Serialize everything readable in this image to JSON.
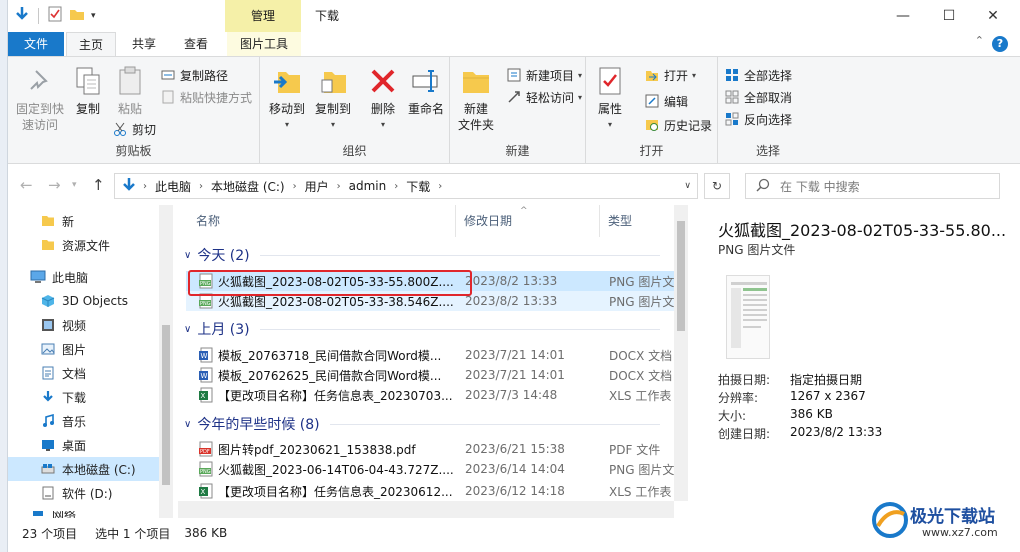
{
  "window": {
    "title": "下载",
    "manage_tab": "管理"
  },
  "tabs": {
    "file": "文件",
    "home": "主页",
    "share": "共享",
    "view": "查看",
    "picture_tools": "图片工具"
  },
  "ribbon": {
    "clipboard": {
      "label": "剪贴板",
      "pin": "固定到快\n速访问",
      "copy": "复制",
      "paste": "粘贴",
      "copy_path": "复制路径",
      "paste_shortcut": "粘贴快捷方式",
      "cut": "剪切"
    },
    "organize": {
      "label": "组织",
      "move_to": "移动到",
      "copy_to": "复制到",
      "delete": "删除",
      "rename": "重命名"
    },
    "new": {
      "label": "新建",
      "new_folder": "新建\n文件夹",
      "new_item": "新建项目",
      "easy_access": "轻松访问"
    },
    "open": {
      "label": "打开",
      "properties": "属性",
      "open": "打开",
      "edit": "编辑",
      "history": "历史记录"
    },
    "select": {
      "label": "选择",
      "select_all": "全部选择",
      "select_none": "全部取消",
      "invert": "反向选择"
    }
  },
  "address": {
    "crumbs": [
      "此电脑",
      "本地磁盘 (C:)",
      "用户",
      "admin",
      "下载"
    ],
    "search_placeholder": "在 下载 中搜索"
  },
  "nav": {
    "items": [
      {
        "label": "新",
        "icon": "folder-icon"
      },
      {
        "label": "资源文件",
        "icon": "folder-icon"
      },
      {
        "label": "此电脑",
        "icon": "computer-icon"
      },
      {
        "label": "3D Objects",
        "icon": "cube-icon"
      },
      {
        "label": "视频",
        "icon": "video-icon"
      },
      {
        "label": "图片",
        "icon": "picture-icon"
      },
      {
        "label": "文档",
        "icon": "document-icon"
      },
      {
        "label": "下载",
        "icon": "download-icon"
      },
      {
        "label": "音乐",
        "icon": "music-icon"
      },
      {
        "label": "桌面",
        "icon": "desktop-icon"
      },
      {
        "label": "本地磁盘 (C:)",
        "icon": "drive-icon"
      },
      {
        "label": "软件 (D:)",
        "icon": "drive-icon"
      },
      {
        "label": "网络",
        "icon": "network-icon"
      }
    ]
  },
  "columns": {
    "name": "名称",
    "date": "修改日期",
    "type": "类型"
  },
  "groups": [
    {
      "title": "今天 (2)",
      "files": [
        {
          "name": "火狐截图_2023-08-02T05-33-55.800Z....",
          "date": "2023/8/2 13:33",
          "type": "PNG 图片文件",
          "icon": "png"
        },
        {
          "name": "火狐截图_2023-08-02T05-33-38.546Z....",
          "date": "2023/8/2 13:33",
          "type": "PNG 图片文件",
          "icon": "png"
        }
      ]
    },
    {
      "title": "上月 (3)",
      "files": [
        {
          "name": "模板_20763718_民间借款合同Word模...",
          "date": "2023/7/21 14:01",
          "type": "DOCX 文档",
          "icon": "docx"
        },
        {
          "name": "模板_20762625_民间借款合同Word模...",
          "date": "2023/7/21 14:01",
          "type": "DOCX 文档",
          "icon": "docx"
        },
        {
          "name": "【更改项目名称】任务信息表_20230703...",
          "date": "2023/7/3 14:48",
          "type": "XLS 工作表",
          "icon": "xls"
        }
      ]
    },
    {
      "title": "今年的早些时候 (8)",
      "files": [
        {
          "name": "图片转pdf_20230621_153838.pdf",
          "date": "2023/6/21 15:38",
          "type": "PDF 文件",
          "icon": "pdf"
        },
        {
          "name": "火狐截图_2023-06-14T06-04-43.727Z....",
          "date": "2023/6/14 14:04",
          "type": "PNG 图片文件",
          "icon": "png"
        },
        {
          "name": "【更改项目名称】任务信息表_20230612...",
          "date": "2023/6/12 14:18",
          "type": "XLS 工作表",
          "icon": "xls"
        }
      ]
    }
  ],
  "preview": {
    "title": "火狐截图_2023-08-02T05-33-55.80...",
    "subtitle": "PNG 图片文件",
    "props": [
      {
        "k": "拍摄日期:",
        "v": "指定拍摄日期"
      },
      {
        "k": "分辨率:",
        "v": "1267 x 2367"
      },
      {
        "k": "大小:",
        "v": "386 KB"
      },
      {
        "k": "创建日期:",
        "v": "2023/8/2 13:33"
      }
    ]
  },
  "status": {
    "count": "23 个项目",
    "selected": "选中 1 个项目",
    "size": "386 KB"
  },
  "watermark": {
    "text": "极光下载站",
    "url": "www.xz7.com"
  },
  "colors": {
    "accent": "#1979ca",
    "selection": "#cce8ff",
    "highlight_box": "#e0262b",
    "manage_tab": "#f5f0a8"
  }
}
